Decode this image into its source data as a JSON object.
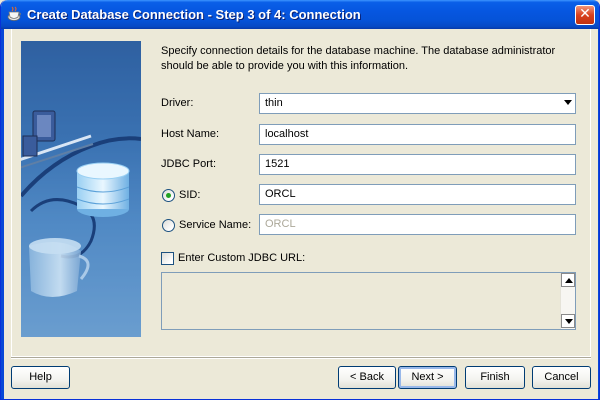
{
  "window": {
    "title": "Create Database Connection - Step 3 of 4: Connection",
    "close_glyph": "✕"
  },
  "intro": "Specify connection details for the database machine. The database administrator should be able to provide you with this information.",
  "form": {
    "driver": {
      "label": "Driver:",
      "value": "thin"
    },
    "host": {
      "label": "Host Name:",
      "value": "localhost"
    },
    "port": {
      "label": "JDBC Port:",
      "value": "1521"
    },
    "sid": {
      "label": "SID:",
      "value": "ORCL",
      "selected": true
    },
    "service": {
      "label": "Service Name:",
      "value": "ORCL",
      "enabled": false
    },
    "custom_url": {
      "label": "Enter Custom JDBC URL:",
      "checked": false,
      "value": ""
    }
  },
  "buttons": {
    "help": "Help",
    "back": "< Back",
    "next": "Next >",
    "finish": "Finish",
    "cancel": "Cancel"
  },
  "colors": {
    "titlebar": "#0553d8",
    "dialog_bg": "#ece9d8",
    "field_border": "#7f9db9",
    "disabled_text": "#aca899"
  },
  "icons": [
    "app-cup-icon",
    "close-icon",
    "chevron-down-icon",
    "scroll-up-icon",
    "scroll-down-icon",
    "database-illustration"
  ]
}
